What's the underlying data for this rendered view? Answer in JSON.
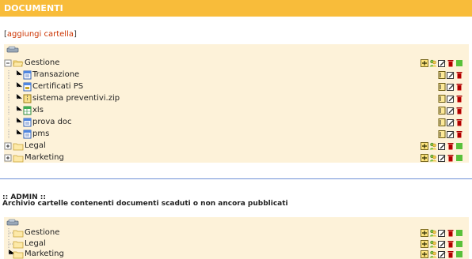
{
  "header": {
    "title": "DOCUMENTI"
  },
  "add_folder": {
    "bracket_open": "[",
    "label": "aggiungi cartella",
    "bracket_close": "]"
  },
  "tree": {
    "items": [
      {
        "label": "Gestione",
        "kind": "folder",
        "expanded": true
      },
      {
        "label": "Transazione",
        "kind": "file"
      },
      {
        "label": "Certificati PS",
        "kind": "file"
      },
      {
        "label": "sistema preventivi.zip",
        "kind": "file"
      },
      {
        "label": "xls",
        "kind": "file"
      },
      {
        "label": "prova doc",
        "kind": "file"
      },
      {
        "label": "pms",
        "kind": "file"
      },
      {
        "label": "Legal",
        "kind": "folder",
        "expanded": false
      },
      {
        "label": "Marketing",
        "kind": "folder",
        "expanded": false
      }
    ]
  },
  "admin": {
    "title": ":: ADMIN ::",
    "subtitle": "Archivio cartelle contenenti documenti scaduti o non ancora pubblicati",
    "items": [
      {
        "label": "Gestione"
      },
      {
        "label": "Legal"
      },
      {
        "label": "Marketing"
      }
    ]
  },
  "colors": {
    "header_bg": "#f8bc3a",
    "panel_bg": "#fdf2d9",
    "link": "#cc3300",
    "divider": "#6d8fd6"
  }
}
